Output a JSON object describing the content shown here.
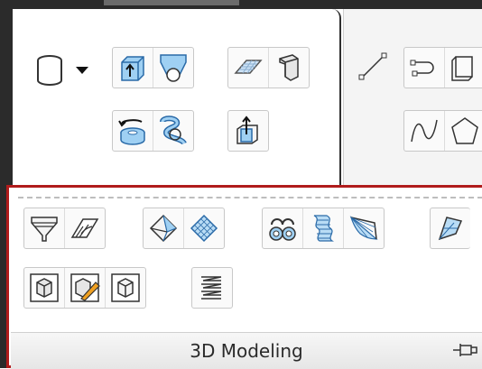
{
  "ribbon": {
    "panel_label": "3D Modeling"
  },
  "icons": {
    "cylinder_dropdown": "cylinder-icon",
    "extrude": "extrude-icon",
    "loft": "loft-icon",
    "revolve": "revolve-icon",
    "sweep": "sweep-icon",
    "presspull": "presspull-icon",
    "planar_surface": "planar-surface-icon",
    "polysolid": "polysolid-icon",
    "line": "line-icon",
    "polyline": "polyline-icon",
    "spline": "spline-icon",
    "pin": "pin-icon"
  },
  "colors": {
    "highlight_border": "#b01c1c",
    "icon_blue": "#3a8fd8"
  }
}
